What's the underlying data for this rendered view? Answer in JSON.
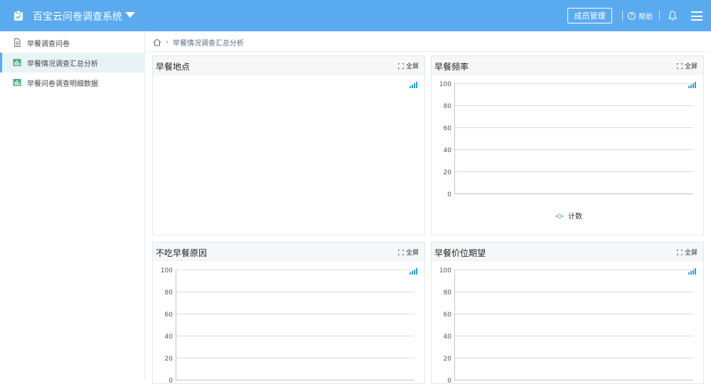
{
  "header": {
    "app_title": "百宝云问卷调查系统",
    "member_btn": "成员管理",
    "help": "帮助",
    "help_glyph": "?"
  },
  "sidebar": {
    "items": [
      {
        "label": "早餐调查问卷",
        "icon": "document-icon",
        "active": false
      },
      {
        "label": "早餐情况调查汇总分析",
        "icon": "chart-icon",
        "active": true
      },
      {
        "label": "早餐问卷调查明细数据",
        "icon": "chart-icon",
        "active": false
      }
    ]
  },
  "breadcrumb": {
    "current": "早餐情况调查汇总分析"
  },
  "panels": {
    "fullscreen_label": "全屏",
    "p1": {
      "title": "早餐地点"
    },
    "p2": {
      "title": "早餐频率"
    },
    "p3": {
      "title": "不吃早餐原因"
    },
    "p4": {
      "title": "早餐价位期望"
    }
  },
  "colors": {
    "header": "#5aaaf0",
    "active_bg": "#e8f3f6",
    "series": "#7cb5ec"
  },
  "chart_data": [
    {
      "type": "line",
      "title": "早餐频率",
      "ylim": [
        0,
        100
      ],
      "yticks": [
        0,
        20,
        40,
        60,
        80,
        100
      ],
      "series": [
        {
          "name": "计数",
          "values": []
        }
      ],
      "legend": "bottom"
    },
    {
      "type": "line",
      "title": "不吃早餐原因",
      "ylim": [
        0,
        100
      ],
      "yticks": [
        0,
        20,
        40,
        60,
        80,
        100
      ],
      "series": []
    },
    {
      "type": "line",
      "title": "早餐价位期望",
      "ylim": [
        0,
        100
      ],
      "yticks": [
        0,
        20,
        40,
        60,
        80,
        100
      ],
      "series": []
    }
  ]
}
